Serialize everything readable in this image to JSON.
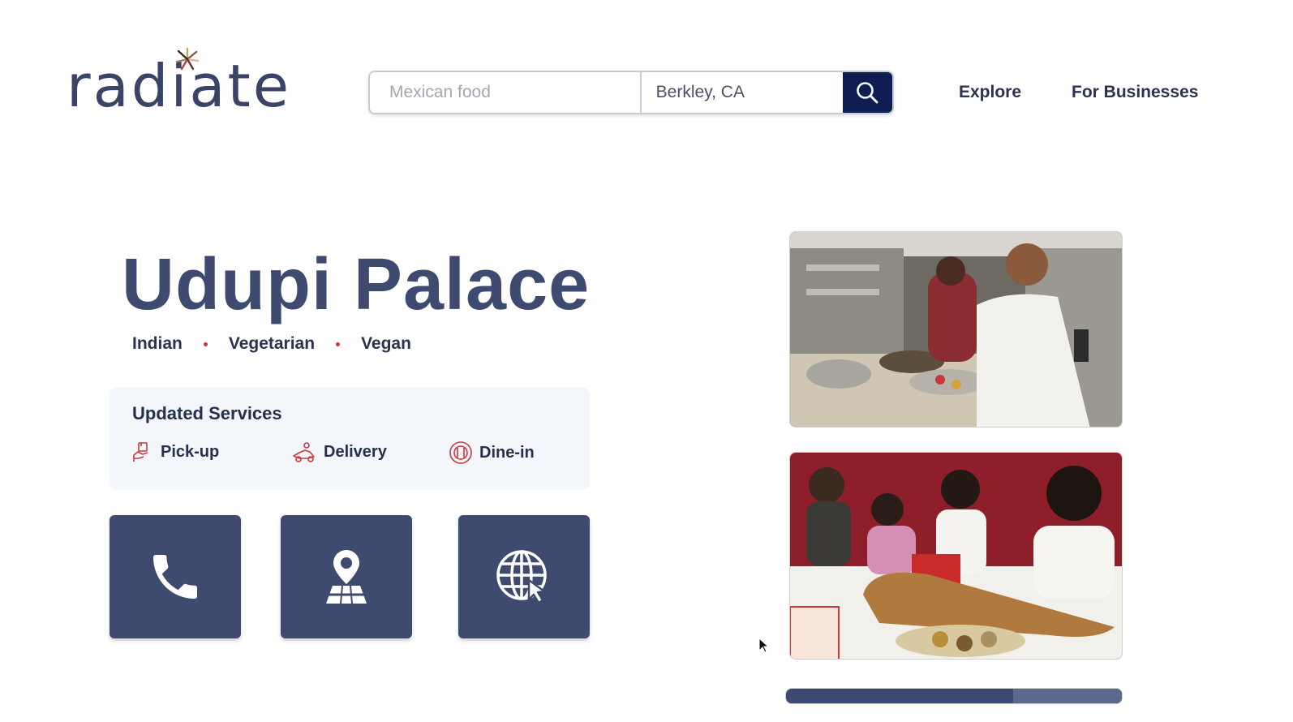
{
  "brand": {
    "name": "radiate"
  },
  "search": {
    "what_placeholder": "Mexican food",
    "where_value": "Berkley, CA"
  },
  "nav": {
    "explore": "Explore",
    "for_businesses": "For Businesses"
  },
  "restaurant": {
    "name": "Udupi Palace",
    "tags": [
      "Indian",
      "Vegetarian",
      "Vegan"
    ]
  },
  "services": {
    "title": "Updated Services",
    "items": [
      {
        "label": "Pick-up",
        "icon": "pickup-icon"
      },
      {
        "label": "Delivery",
        "icon": "delivery-icon"
      },
      {
        "label": "Dine-in",
        "icon": "dine-in-icon"
      }
    ]
  },
  "actions": [
    {
      "icon": "phone-icon"
    },
    {
      "icon": "map-pin-icon"
    },
    {
      "icon": "website-globe-icon"
    }
  ],
  "colors": {
    "primary": "#3e4a6e",
    "search_button": "#0f1e52",
    "accent_red": "#c9383d",
    "services_bg": "#f3f6fb"
  }
}
